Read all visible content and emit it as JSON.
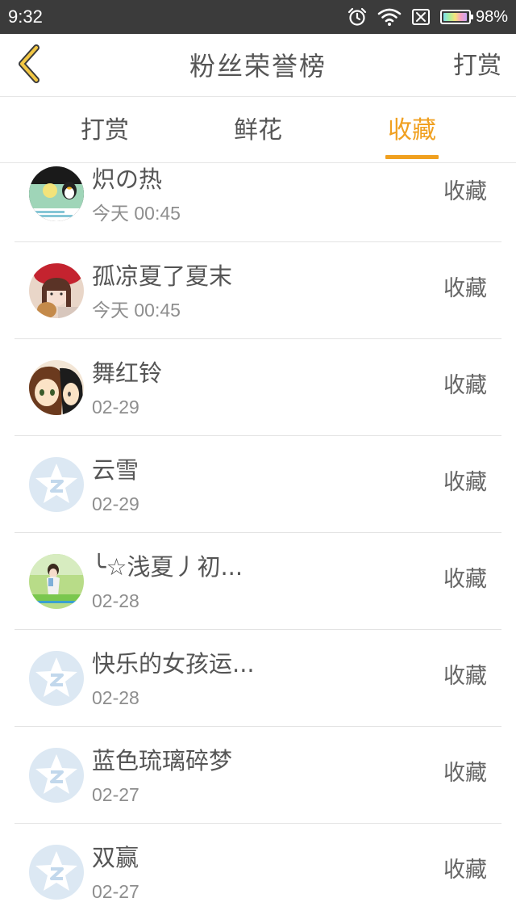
{
  "status_bar": {
    "time": "9:32",
    "battery_percent": "98%",
    "icons": [
      "alarm-icon",
      "wifi-icon",
      "sim-off-icon",
      "battery-icon"
    ]
  },
  "header": {
    "back_icon": "chevron-left-icon",
    "title": "粉丝荣誉榜",
    "action_label": "打赏"
  },
  "tabs": [
    {
      "label": "打赏",
      "active": false
    },
    {
      "label": "鲜花",
      "active": false
    },
    {
      "label": "收藏",
      "active": true
    }
  ],
  "colors": {
    "accent": "#f0a020",
    "status_bar": "#3b3b3b",
    "text": "#555555",
    "subtext": "#8e8e8e",
    "divider": "#e3e3e3",
    "default_avatar": "#dce8f3"
  },
  "fans": [
    {
      "name": "炽の热",
      "time": "今天 00:45",
      "action": "收藏",
      "avatar": "qq-penguin-avatar"
    },
    {
      "name": "孤凉夏了夏末",
      "time": "今天 00:45",
      "action": "收藏",
      "avatar": "girl-red-hat-avatar"
    },
    {
      "name": "舞红铃",
      "time": "02-29",
      "action": "收藏",
      "avatar": "anime-girls-avatar"
    },
    {
      "name": "云雪",
      "time": "02-29",
      "action": "收藏",
      "avatar": "default-star-avatar"
    },
    {
      "name": "╰☆浅夏丿初...",
      "time": "02-28",
      "action": "收藏",
      "avatar": "girl-grass-avatar"
    },
    {
      "name": "快乐的女孩运...",
      "time": "02-28",
      "action": "收藏",
      "avatar": "default-star-avatar"
    },
    {
      "name": "蓝色琉璃碎梦",
      "time": "02-27",
      "action": "收藏",
      "avatar": "default-star-avatar"
    },
    {
      "name": "双赢",
      "time": "02-27",
      "action": "收藏",
      "avatar": "default-star-avatar"
    }
  ]
}
